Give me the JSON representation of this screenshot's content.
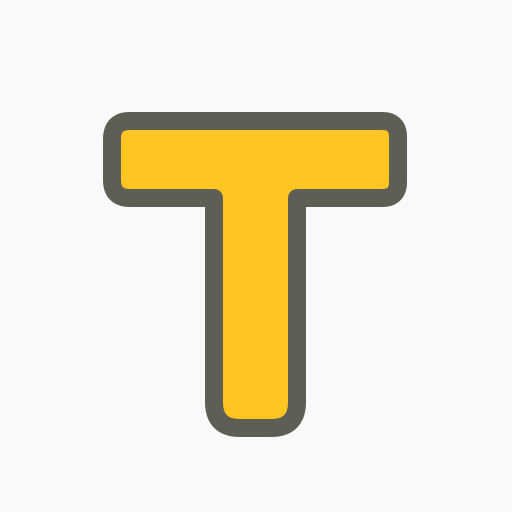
{
  "app_icon": {
    "glyph": "T",
    "icon": "letter-t-icon",
    "colors": {
      "background": "#f9f9f9",
      "fill": "#ffc623",
      "outline": "#5f5e54"
    }
  }
}
